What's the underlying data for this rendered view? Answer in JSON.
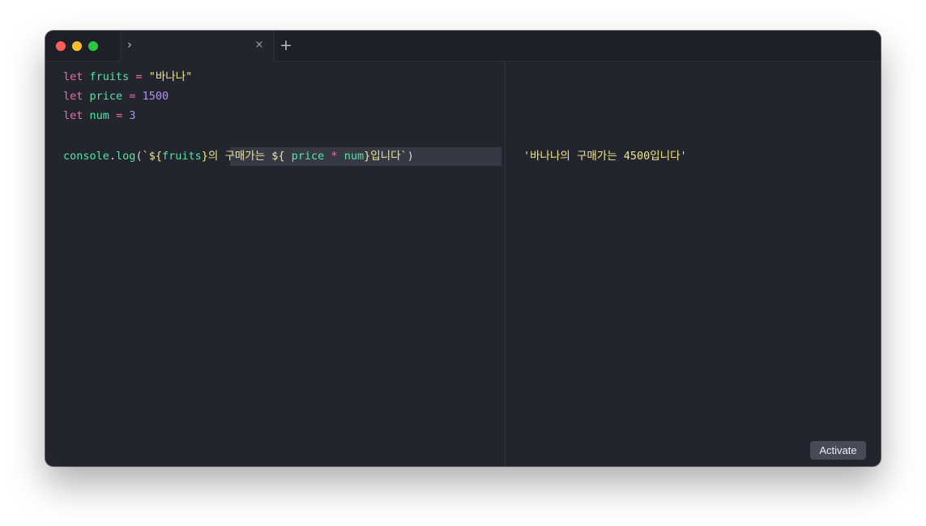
{
  "tabs": {
    "chevron_glyph": "›",
    "close_glyph": "×",
    "new_tab_glyph": "+"
  },
  "colors": {
    "keyword": "#f06ca8",
    "identifier": "#5ce0a5",
    "string": "#f0e48a",
    "number": "#b490f2",
    "background": "#22252e"
  },
  "editor": {
    "line1": {
      "kw": "let",
      "name": "fruits",
      "op": "=",
      "value": "\"바나나\""
    },
    "line2": {
      "kw": "let",
      "name": "price",
      "op": "=",
      "value": "1500"
    },
    "line3": {
      "kw": "let",
      "name": "num",
      "op": "=",
      "value": "3"
    },
    "line5": {
      "obj": "console",
      "dot": ".",
      "method": "log",
      "paren_open": "(",
      "tick_open": "`",
      "interp1_open": "${",
      "interp1_var": "fruits",
      "interp1_close": "}",
      "text1": "의 구매가는 ",
      "interp2_open": "${ ",
      "interp2_var1": "price",
      "interp2_op": "*",
      "interp2_var2": "num",
      "interp2_close": "}",
      "text2": "입니다",
      "tick_close": "`",
      "paren_close": ")"
    }
  },
  "output": {
    "result": "'바나나의 구매가는 4500입니다'"
  },
  "activate_label": "Activate"
}
